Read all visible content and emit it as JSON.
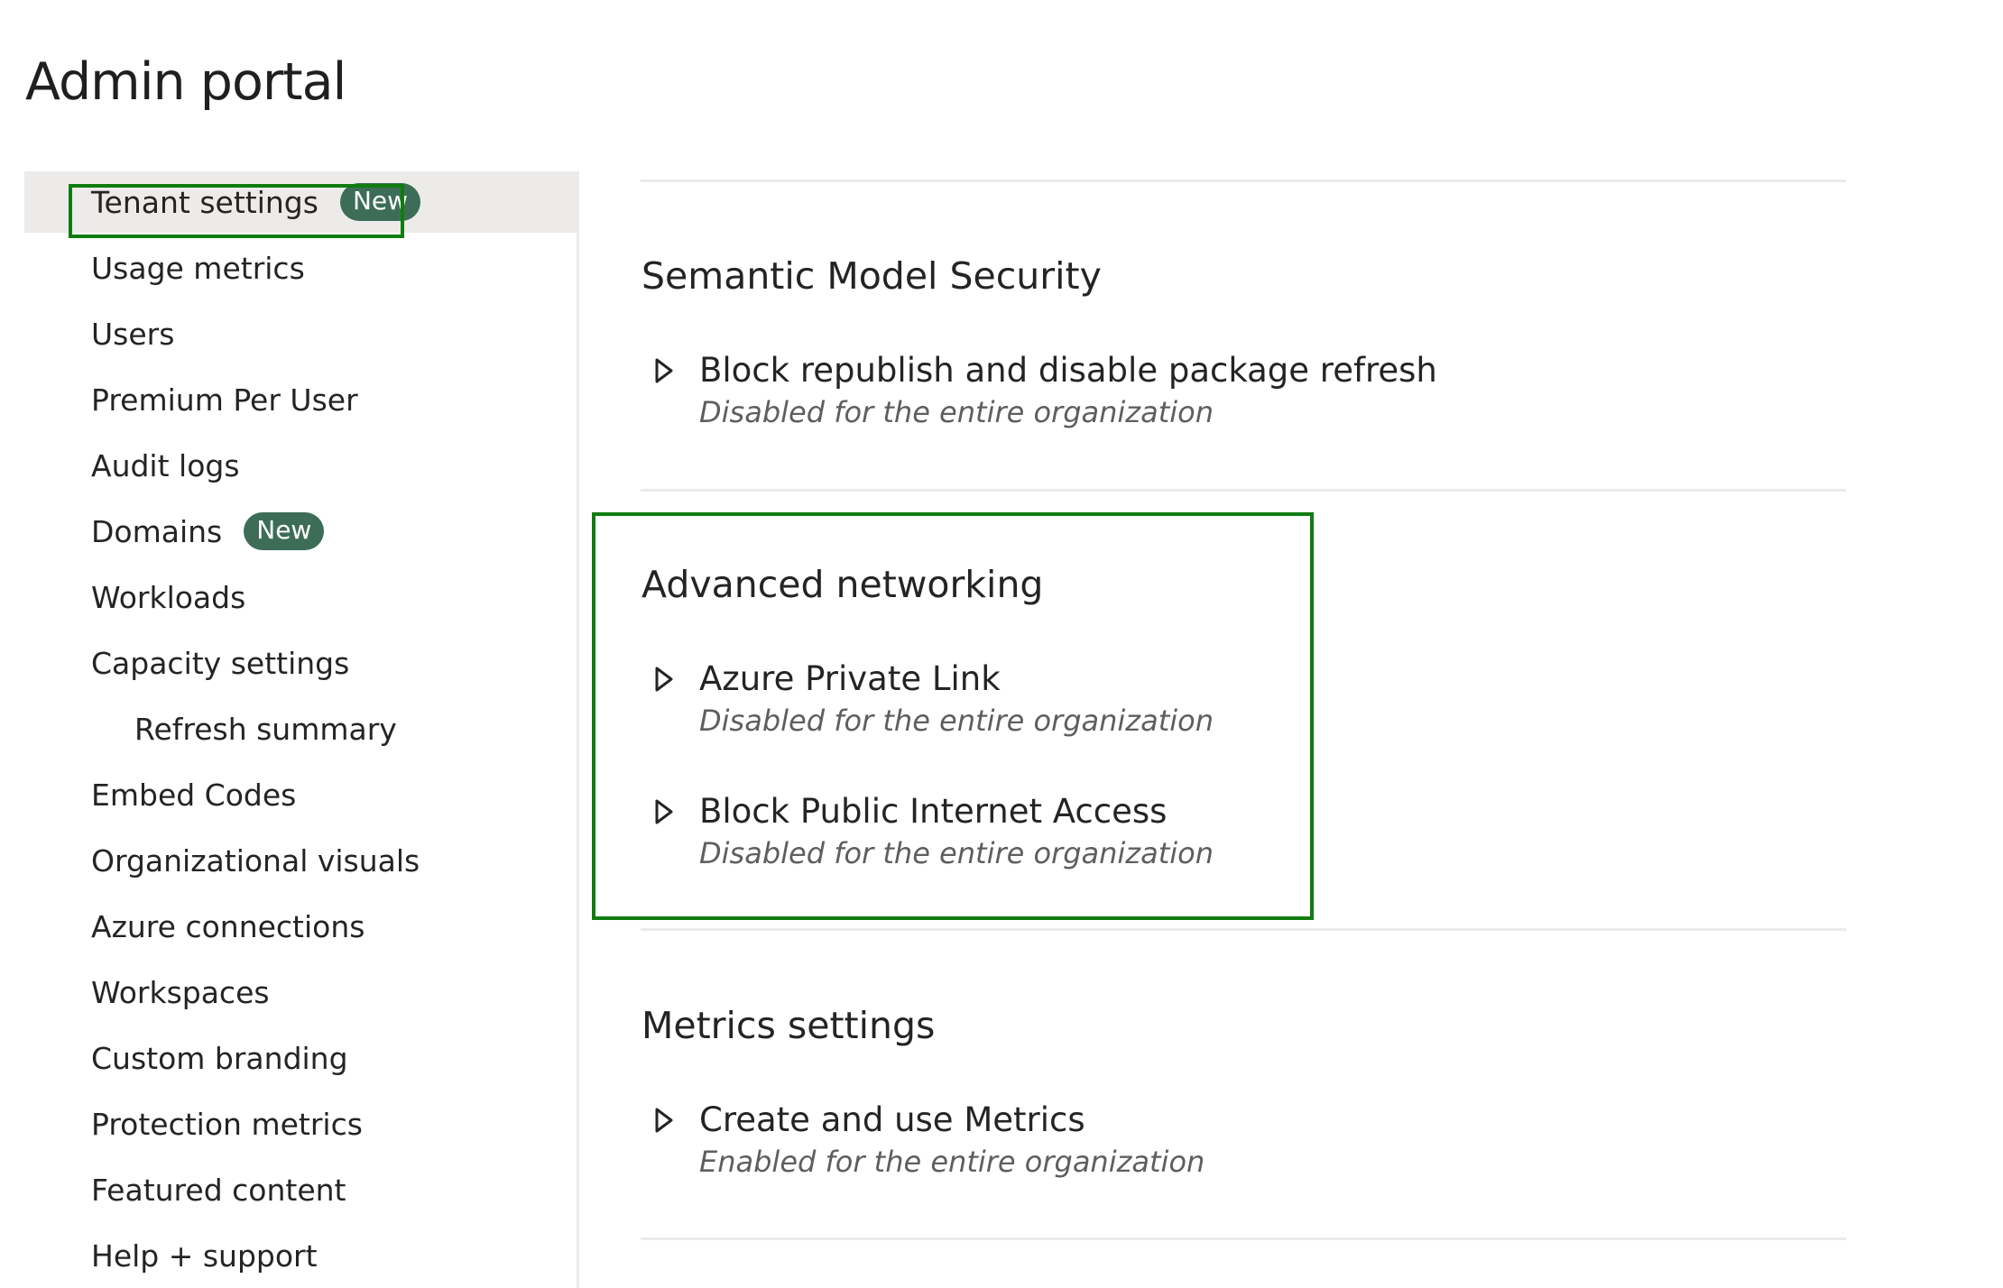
{
  "page": {
    "title": "Admin portal"
  },
  "accent": {
    "highlight": "#107c10",
    "badge": "#3d6d57",
    "selected_bg": "#edebe9"
  },
  "sidebar": {
    "items": [
      {
        "label": "Tenant settings",
        "badge": "New",
        "selected": true
      },
      {
        "label": "Usage metrics"
      },
      {
        "label": "Users"
      },
      {
        "label": "Premium Per User"
      },
      {
        "label": "Audit logs"
      },
      {
        "label": "Domains",
        "badge": "New"
      },
      {
        "label": "Workloads"
      },
      {
        "label": "Capacity settings"
      },
      {
        "label": "Refresh summary",
        "sub": true
      },
      {
        "label": "Embed Codes"
      },
      {
        "label": "Organizational visuals"
      },
      {
        "label": "Azure connections"
      },
      {
        "label": "Workspaces"
      },
      {
        "label": "Custom branding"
      },
      {
        "label": "Protection metrics"
      },
      {
        "label": "Featured content"
      },
      {
        "label": "Help + support"
      }
    ]
  },
  "sections": [
    {
      "title": "Semantic Model Security",
      "settings": [
        {
          "name": "Block republish and disable package refresh",
          "status": "Disabled for the entire organization",
          "icon": "chevron-right-icon"
        }
      ]
    },
    {
      "title": "Advanced networking",
      "settings": [
        {
          "name": "Azure Private Link",
          "status": "Disabled for the entire organization",
          "icon": "chevron-right-icon"
        },
        {
          "name": "Block Public Internet Access",
          "status": "Disabled for the entire organization",
          "icon": "chevron-right-icon"
        }
      ]
    },
    {
      "title": "Metrics settings",
      "settings": [
        {
          "name": "Create and use Metrics",
          "status": "Enabled for the entire organization",
          "icon": "chevron-right-icon"
        }
      ]
    }
  ]
}
